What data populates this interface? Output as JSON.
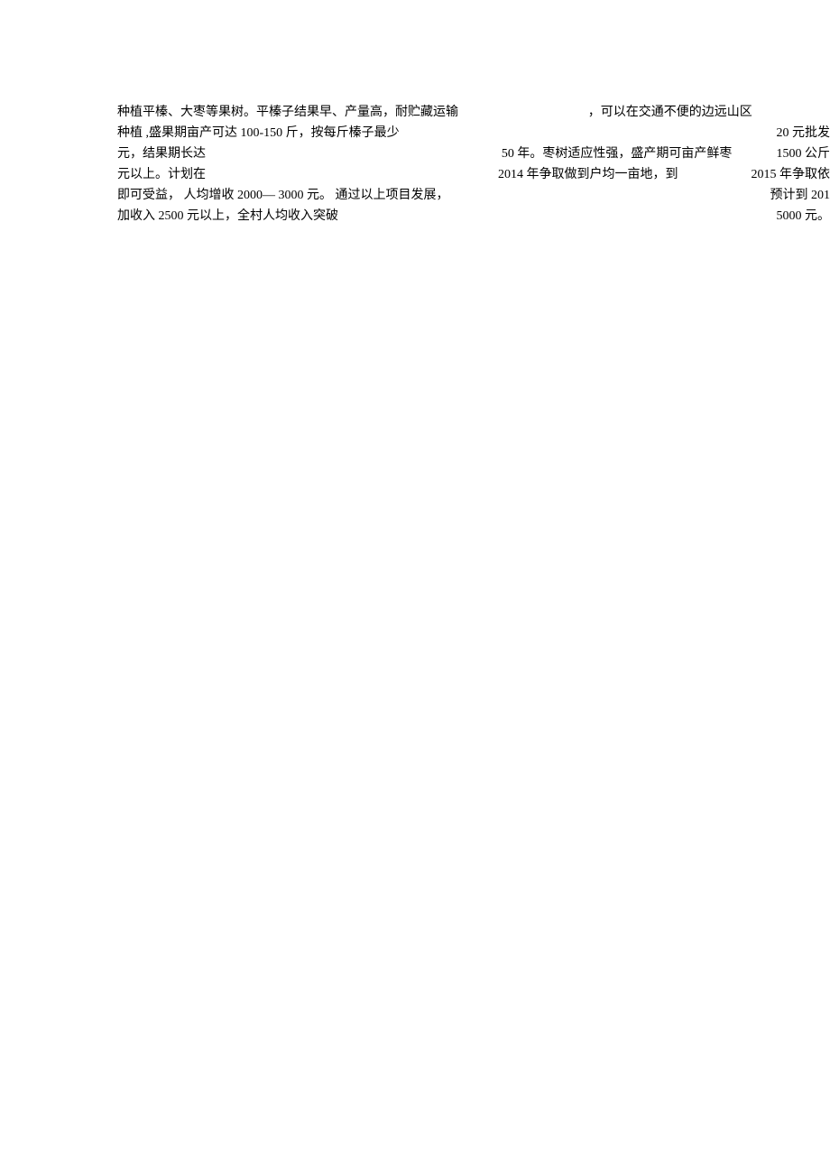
{
  "lines": [
    {
      "left": "种植平榛、大枣等果树。平榛子结果早、产量高，耐贮藏运输",
      "mid": "，可以在交通不便的边远山区",
      "right": ""
    },
    {
      "left": "种植 ,盛果期亩产可达   100-150 斤，按每斤榛子最少",
      "mid": "",
      "right": "20 元批发"
    },
    {
      "left": "元，结果期长达",
      "mid": "50 年。枣树适应性强，盛产期可亩产鲜枣",
      "right": "1500 公斤"
    },
    {
      "left": "元以上。计划在",
      "mid": "2014 年争取做到户均一亩地，到",
      "right": "2015 年争取依"
    },
    {
      "left": "即可受益，  人均增收 2000— 3000 元。 通过以上项目发展，",
      "mid": "",
      "right": "预计到 201"
    },
    {
      "left": "加收入 2500 元以上，全村人均收入突破",
      "mid": "",
      "right": "5000 元。"
    }
  ]
}
